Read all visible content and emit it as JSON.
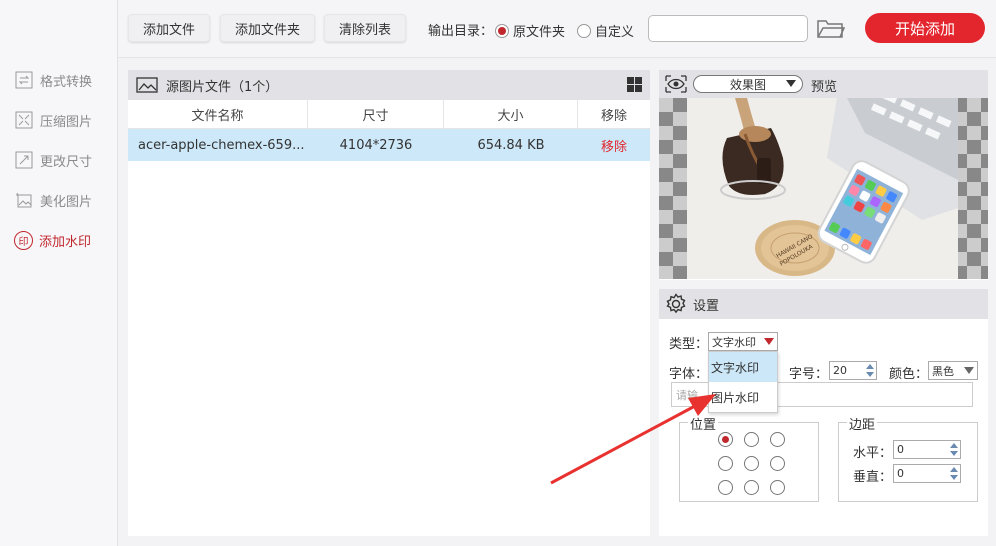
{
  "sidebar": {
    "items": [
      {
        "label": "格式转换",
        "icon": "format-convert-icon",
        "active": false
      },
      {
        "label": "压缩图片",
        "icon": "compress-icon",
        "active": false
      },
      {
        "label": "更改尺寸",
        "icon": "resize-icon",
        "active": false
      },
      {
        "label": "美化图片",
        "icon": "beautify-icon",
        "active": false
      },
      {
        "label": "添加水印",
        "icon": "watermark-icon",
        "active": true,
        "icon_text": "印"
      }
    ]
  },
  "toolbar": {
    "add_file": "添加文件",
    "add_folder": "添加文件夹",
    "clear_list": "清除列表",
    "output_label": "输出目录：",
    "radio_original": "原文件夹",
    "radio_custom": "自定义",
    "selected_output": "原文件夹",
    "path_value": "",
    "start": "开始添加"
  },
  "source": {
    "title": "源图片文件（1个）",
    "columns": [
      "文件名称",
      "尺寸",
      "大小",
      "移除"
    ],
    "rows": [
      {
        "name": "acer-apple-chemex-659...",
        "size": "4104*2736",
        "filesize": "654.84 KB",
        "remove": "移除"
      }
    ]
  },
  "preview": {
    "mode": "效果图",
    "label": "预览"
  },
  "settings": {
    "title": "设置",
    "type_label": "类型：",
    "type_value": "文字水印",
    "font_label": "字体：",
    "size_label": "字号：",
    "size_value": "20",
    "color_label": "颜色：",
    "color_value": "黑色",
    "text_placeholder": "请输",
    "position_label": "位置",
    "position_selected": 0,
    "margin_label": "边距",
    "h_label": "水平：",
    "h_value": "0",
    "v_label": "垂直：",
    "v_value": "0"
  },
  "dropdown": {
    "options": [
      "文字水印",
      "图片水印"
    ],
    "highlighted": 0
  },
  "colors": {
    "accent": "#e3262e",
    "highlight_row": "#cde8f8",
    "annotation_arrow": "#e8322f"
  }
}
